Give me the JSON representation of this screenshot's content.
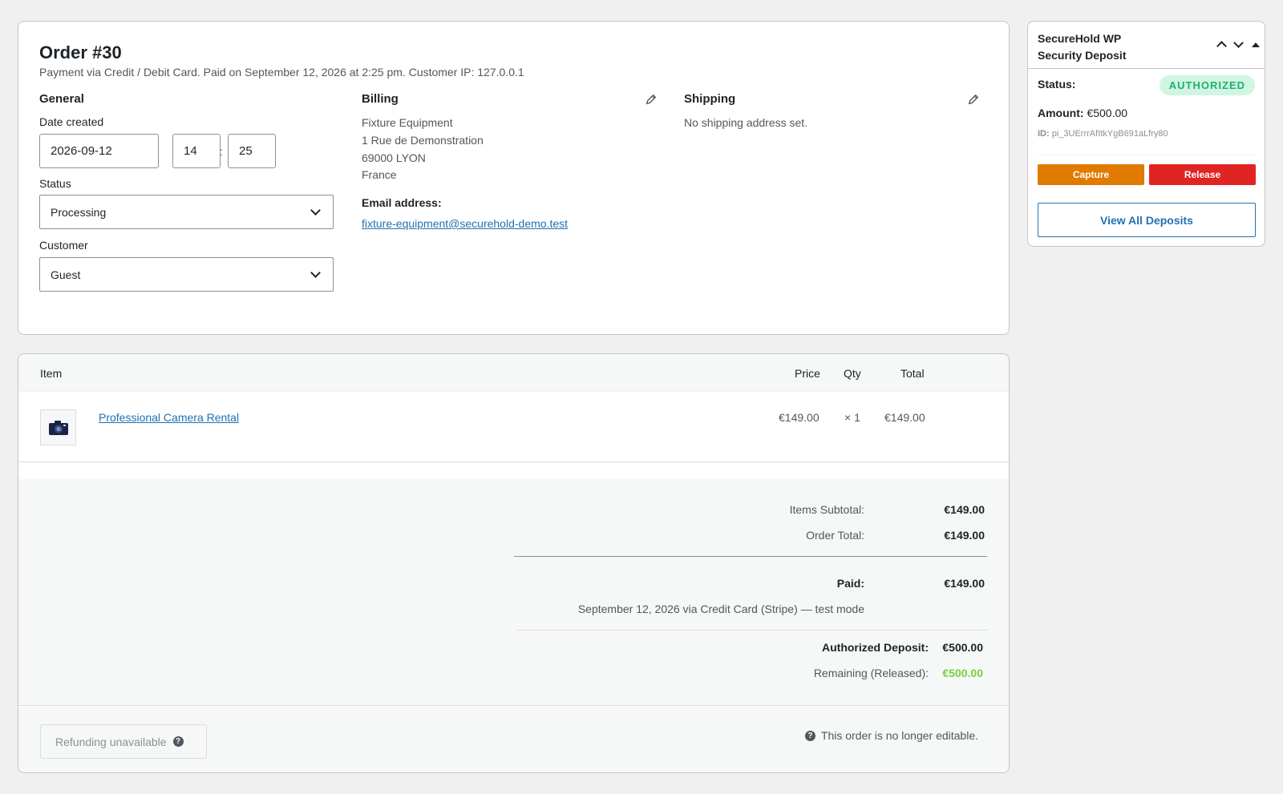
{
  "order": {
    "title": "Order #30",
    "meta": "Payment via Credit / Debit Card. Paid on September 12, 2026 at 2:25 pm. Customer IP: 127.0.0.1",
    "general": {
      "heading": "General",
      "date_label": "Date created",
      "date_value": "2026-09-12",
      "hour_value": "14",
      "minute_value": "25",
      "time_separator": ":",
      "status_label": "Status",
      "status_value": "Processing",
      "customer_label": "Customer",
      "customer_value": "Guest"
    },
    "billing": {
      "heading": "Billing",
      "address_lines": [
        "Fixture Equipment",
        "1 Rue de Demonstration",
        "69000 LYON",
        "France"
      ],
      "email_label": "Email address:",
      "email": "fixture-equipment@securehold-demo.test"
    },
    "shipping": {
      "heading": "Shipping",
      "empty_text": "No shipping address set."
    }
  },
  "items": {
    "headers": {
      "item": "Item",
      "price": "Price",
      "qty": "Qty",
      "total": "Total"
    },
    "rows": [
      {
        "name": "Professional Camera Rental",
        "price": "€149.00",
        "qty": "× 1",
        "total": "€149.00",
        "icon": "camera-icon"
      }
    ],
    "totals": {
      "subtotal_label": "Items Subtotal:",
      "subtotal_value": "€149.00",
      "order_total_label": "Order Total:",
      "order_total_value": "€149.00",
      "paid_label": "Paid:",
      "paid_value": "€149.00",
      "paid_note": "September 12, 2026 via Credit Card (Stripe) — test mode",
      "auth_deposit_label": "Authorized Deposit:",
      "auth_deposit_value": "€500.00",
      "remaining_label": "Remaining (Released):",
      "remaining_value": "€500.00"
    },
    "refund_label": "Refunding unavailable",
    "not_editable": "This order is no longer editable."
  },
  "deposit": {
    "title_line1": "SecureHold WP",
    "title_line2": "Security Deposit",
    "status_label": "Status:",
    "status_value": "AUTHORIZED",
    "amount_label": "Amount:",
    "amount_value": "€500.00",
    "id_label": "ID:",
    "id_value": "pi_3UErrrAfItkYgB691aLfry80",
    "capture_label": "Capture",
    "release_label": "Release",
    "view_all_label": "View All Deposits"
  },
  "colors": {
    "link": "#2271b1",
    "capture": "#e07b00",
    "release": "#e02424",
    "authorized_badge": "#1bb26a",
    "released_amount": "#7ad03a"
  }
}
